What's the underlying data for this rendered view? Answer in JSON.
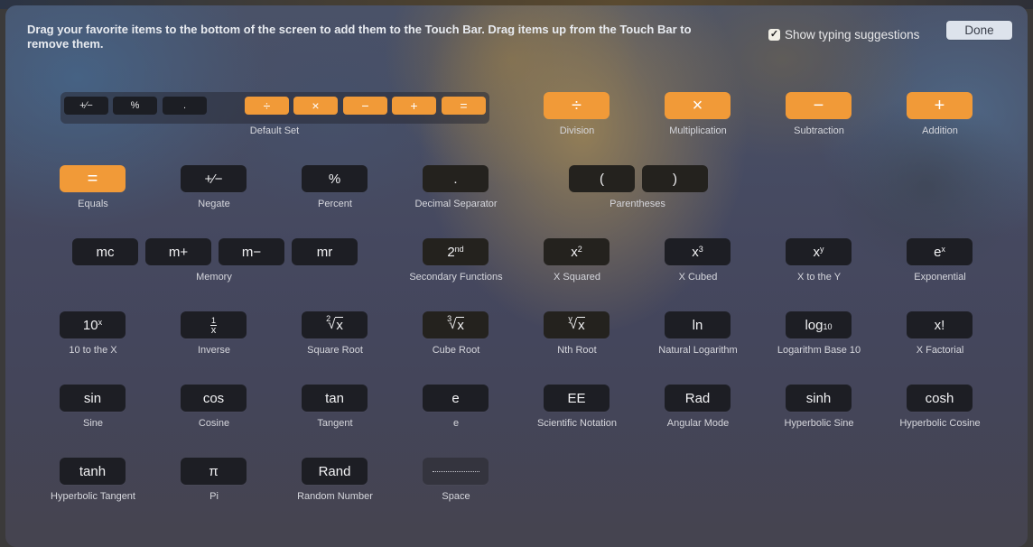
{
  "header": {
    "instructions": "Drag your favorite items to the bottom of the screen to add them to the Touch Bar. Drag items up from the Touch Bar to remove them.",
    "show_suggestions_label": "Show typing suggestions",
    "show_suggestions_checked": true,
    "checkmark": "✓",
    "done_label": "Done"
  },
  "colors": {
    "operator_orange": "#f19a38",
    "key_dark": "#1d1e24",
    "done_bg": "#dde3ec"
  },
  "default_set": {
    "label": "Default Set",
    "keys": [
      "+⁄−",
      "%",
      ".",
      "÷",
      "×",
      "−",
      "+",
      "="
    ]
  },
  "items": {
    "division": {
      "key": "÷",
      "label": "Division"
    },
    "multiplication": {
      "key": "×",
      "label": "Multiplication"
    },
    "subtraction": {
      "key": "−",
      "label": "Subtraction"
    },
    "addition": {
      "key": "+",
      "label": "Addition"
    },
    "equals": {
      "key": "=",
      "label": "Equals"
    },
    "negate": {
      "key": "+⁄−",
      "label": "Negate"
    },
    "percent": {
      "key": "%",
      "label": "Percent"
    },
    "decimal": {
      "key": ".",
      "label": "Decimal Separator"
    },
    "parentheses": {
      "open": "(",
      "close": ")",
      "label": "Parentheses"
    },
    "memory": {
      "keys": [
        "mc",
        "m+",
        "m−",
        "mr"
      ],
      "label": "Memory"
    },
    "second": {
      "base": "2",
      "sup": "nd",
      "label": "Secondary Functions"
    },
    "x_squared": {
      "base": "x",
      "sup": "2",
      "label": "X Squared"
    },
    "x_cubed": {
      "base": "x",
      "sup": "3",
      "label": "X Cubed"
    },
    "x_to_y": {
      "base": "x",
      "sup": "y",
      "label": "X to the Y"
    },
    "exponential": {
      "base": "e",
      "sup": "x",
      "label": "Exponential"
    },
    "ten_to_x": {
      "base": "10",
      "sup": "x",
      "label": "10 to the X"
    },
    "inverse": {
      "num": "1",
      "den": "x",
      "label": "Inverse"
    },
    "square_root": {
      "idx": "2",
      "rad": "x",
      "label": "Square Root"
    },
    "cube_root": {
      "idx": "3",
      "rad": "x",
      "label": "Cube Root"
    },
    "nth_root": {
      "idx": "y",
      "rad": "x",
      "label": "Nth Root"
    },
    "ln": {
      "key": "ln",
      "label": "Natural Logarithm"
    },
    "log10": {
      "base": "log",
      "sub": "10",
      "label": "Logarithm Base 10"
    },
    "factorial": {
      "key": "x!",
      "label": "X Factorial"
    },
    "sin": {
      "key": "sin",
      "label": "Sine"
    },
    "cos": {
      "key": "cos",
      "label": "Cosine"
    },
    "tan": {
      "key": "tan",
      "label": "Tangent"
    },
    "e": {
      "key": "e",
      "label": "e"
    },
    "ee": {
      "key": "EE",
      "label": "Scientific Notation"
    },
    "rad": {
      "key": "Rad",
      "label": "Angular Mode"
    },
    "sinh": {
      "key": "sinh",
      "label": "Hyperbolic Sine"
    },
    "cosh": {
      "key": "cosh",
      "label": "Hyperbolic Cosine"
    },
    "tanh": {
      "key": "tanh",
      "label": "Hyperbolic Tangent"
    },
    "pi": {
      "key": "π",
      "label": "Pi"
    },
    "rand": {
      "key": "Rand",
      "label": "Random Number"
    },
    "space": {
      "label": "Space"
    }
  }
}
